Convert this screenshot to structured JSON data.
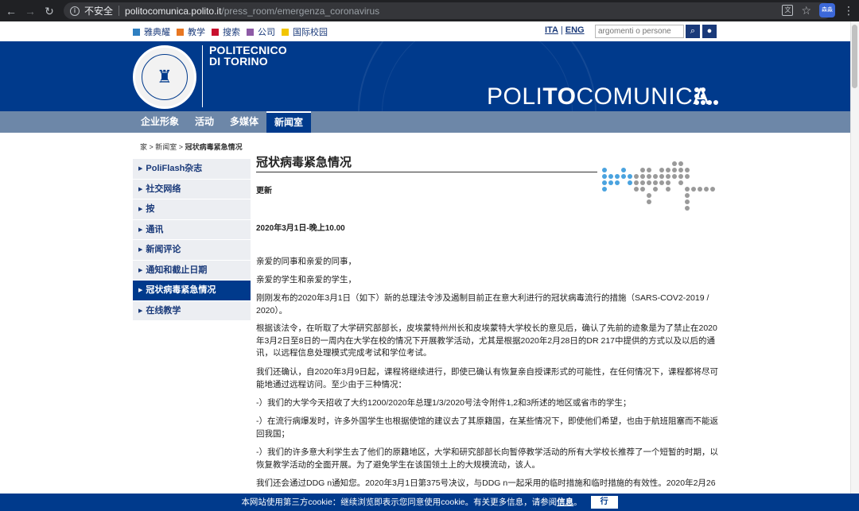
{
  "browser": {
    "insecure_label": "不安全",
    "url_host": "politocomunica.polito.it",
    "url_path": "/press_room/emergenza_coronavirus",
    "profile_label": "森淼"
  },
  "topbar": {
    "links": [
      {
        "label": "雅典耀",
        "color": "#2e7fc1"
      },
      {
        "label": "教学",
        "color": "#e87722"
      },
      {
        "label": "搜索",
        "color": "#c8102e"
      },
      {
        "label": "公司",
        "color": "#8e5ba6"
      },
      {
        "label": "国际校园",
        "color": "#f2c500"
      }
    ],
    "lang_ita": "ITA",
    "lang_sep": "|",
    "lang_eng": "ENG",
    "search_placeholder": "argomenti o persone"
  },
  "header": {
    "logo_line1": "POLITECNICO",
    "logo_line2": "DI TORINO",
    "brand_pre": "POLI",
    "brand_bold": "TO",
    "brand_post": "COMUNICA",
    "bg_color": "#003a8c"
  },
  "mainnav": {
    "items": [
      "企业形象",
      "活动",
      "多媒体",
      "新闻室"
    ]
  },
  "breadcrumb": {
    "home": "家",
    "sep": " > ",
    "newsroom": "新闻室",
    "current": "冠状病毒紧急情况"
  },
  "sidebar": {
    "items": [
      "PoliFlash杂志",
      "社交网络",
      "按",
      "通讯",
      "新闻评论",
      "通知和截止日期",
      "冠状病毒紧急情况",
      "在线教学"
    ]
  },
  "content": {
    "title": "冠状病毒紧急情况",
    "subhead": "更新",
    "dateline": "2020年3月1日-晚上10.00",
    "paragraphs": [
      "亲爱的同事和亲爱的同事，",
      "亲爱的学生和亲爱的学生，",
      "刚刚发布的2020年3月1日（如下）新的总理法令涉及遏制目前正在意大利进行的冠状病毒流行的措施（SARS-COV2-2019 / 2020）。",
      "根据该法令，在听取了大学研究部部长，皮埃蒙特州州长和皮埃蒙特大学校长的意见后，确认了先前的迹象是为了禁止在2020年3月2日至8日的一周内在大学在校的情况下开展教学活动，尤其是根据2020年2月28日的DR 217中提供的方式以及以后的通讯，以远程信息处理模式完成考试和学位考试。",
      "我们还确认，自2020年3月9日起，课程将继续进行，即使已确认有恢复亲自授课形式的可能性，在任何情况下，课程都将尽可能地通过远程访问。至少由于三种情况：",
      "-）我们的大学今天招收了大约1200/2020年总理1/3/2020号法令附件1,2和3所述的地区或省市的学生；",
      "-）在流行病爆发时，许多外国学生也根据使馆的建议去了其原籍国，在某些情况下，即使他们希望，也由于航班阻塞而不能返回我国；",
      "-）我们的许多意大利学生去了他们的原籍地区，大学和研究部部长向暂停教学活动的所有大学校长推荐了一个短暂的时期，以恢复教学活动的全面开展。为了避免学生在该国领土上的大规模流动，该人。",
      "我们还会通过DDG n通知您。2020年3月1日第375号决议，与DDG n一起采用的临时措施和临时措施的有效性。2020年2月26"
    ]
  },
  "cookie": {
    "text": "本网站使用第三方cookie：继续浏览即表示您同意使用cookie。有关更多信息，请参阅",
    "link": "信息",
    "end": "。",
    "button": "行"
  }
}
